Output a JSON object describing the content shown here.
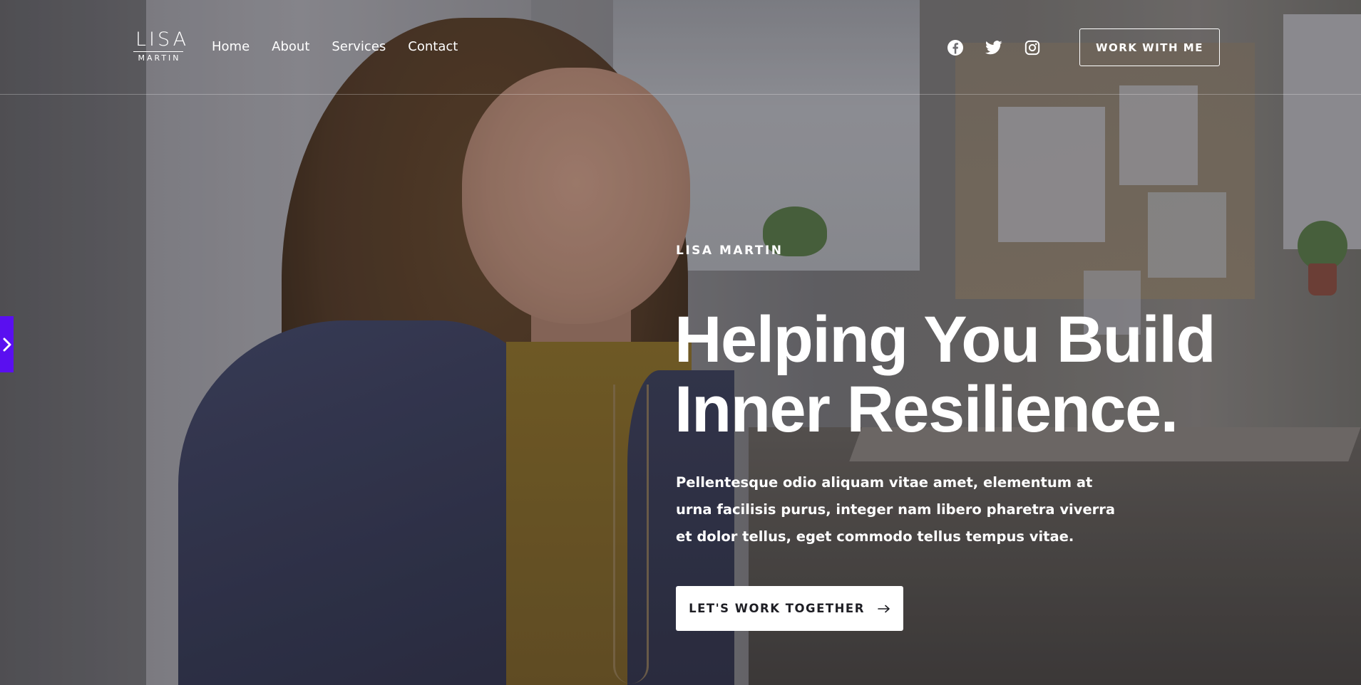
{
  "header": {
    "logo": {
      "top": "LISA",
      "bottom": "MARTIN"
    },
    "nav": [
      {
        "label": "Home"
      },
      {
        "label": "About"
      },
      {
        "label": "Services"
      },
      {
        "label": "Contact"
      }
    ],
    "social": [
      {
        "icon": "facebook-icon"
      },
      {
        "icon": "twitter-icon"
      },
      {
        "icon": "instagram-icon"
      }
    ],
    "cta_label": "WORK WITH ME"
  },
  "hero": {
    "eyebrow": "LISA MARTIN",
    "headline_line1": "Helping You Build",
    "headline_line2": "Inner Resilience.",
    "lede": "Pellentesque odio aliquam vitae amet, elementum at urna facilisis purus, integer nam libero pharetra viverra et dolor tellus, eget commodo tellus tempus vitae.",
    "cta_label": "LET'S WORK TOGETHER"
  },
  "side_tab": {
    "icon": "chevron-right-icon",
    "color": "#5a0ff0"
  },
  "colors": {
    "text": "#ffffff",
    "button_bg": "#ffffff",
    "button_text": "#1e1e24",
    "accent": "#5a0ff0"
  }
}
